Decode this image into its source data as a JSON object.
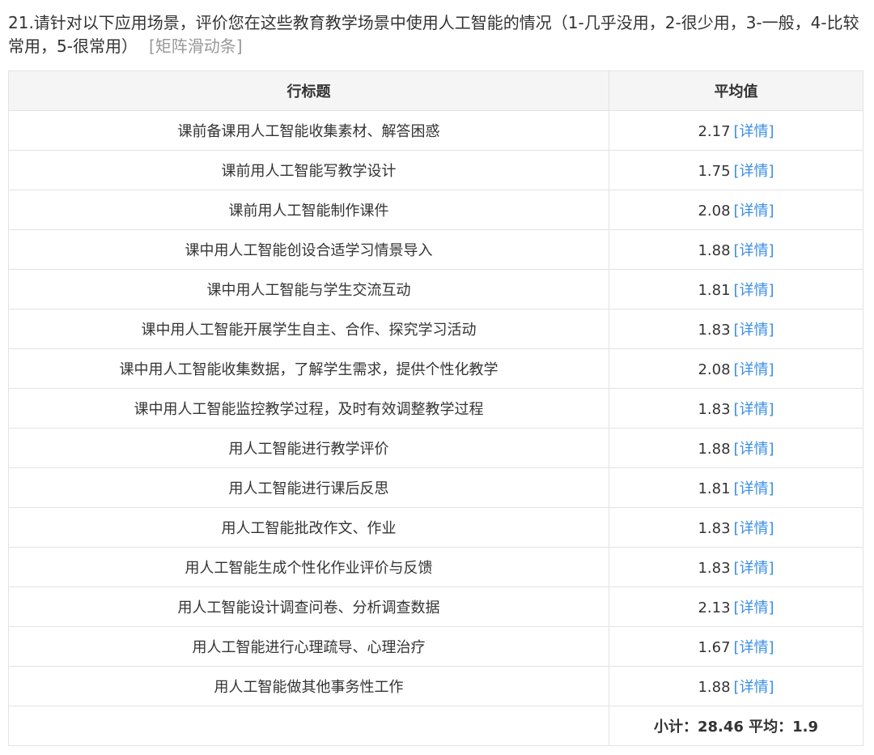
{
  "question": {
    "text": "21.请针对以下应用场景，评价您在这些教育教学场景中使用人工智能的情况（1-几乎没用，2-很少用，3-一般，4-比较常用，5-很常用）",
    "tag": "[矩阵滑动条]"
  },
  "table": {
    "headers": [
      "行标题",
      "平均值"
    ],
    "detail_label": "[详情]",
    "rows": [
      {
        "label": "课前备课用人工智能收集素材、解答困惑",
        "value": "2.17"
      },
      {
        "label": "课前用人工智能写教学设计",
        "value": "1.75"
      },
      {
        "label": "课前用人工智能制作课件",
        "value": "2.08"
      },
      {
        "label": "课中用人工智能创设合适学习情景导入",
        "value": "1.88"
      },
      {
        "label": "课中用人工智能与学生交流互动",
        "value": "1.81"
      },
      {
        "label": "课中用人工智能开展学生自主、合作、探究学习活动",
        "value": "1.83"
      },
      {
        "label": "课中用人工智能收集数据，了解学生需求，提供个性化教学",
        "value": "2.08"
      },
      {
        "label": "课中用人工智能监控教学过程，及时有效调整教学过程",
        "value": "1.83"
      },
      {
        "label": "用人工智能进行教学评价",
        "value": "1.88"
      },
      {
        "label": "用人工智能进行课后反思",
        "value": "1.81"
      },
      {
        "label": "用人工智能批改作文、作业",
        "value": "1.83"
      },
      {
        "label": "用人工智能生成个性化作业评价与反馈",
        "value": "1.83"
      },
      {
        "label": "用人工智能设计调查问卷、分析调查数据",
        "value": "2.13"
      },
      {
        "label": "用人工智能进行心理疏导、心理治疗",
        "value": "1.67"
      },
      {
        "label": "用人工智能做其他事务性工作",
        "value": "1.88"
      }
    ],
    "summary": "小计：28.46 平均：1.9"
  }
}
